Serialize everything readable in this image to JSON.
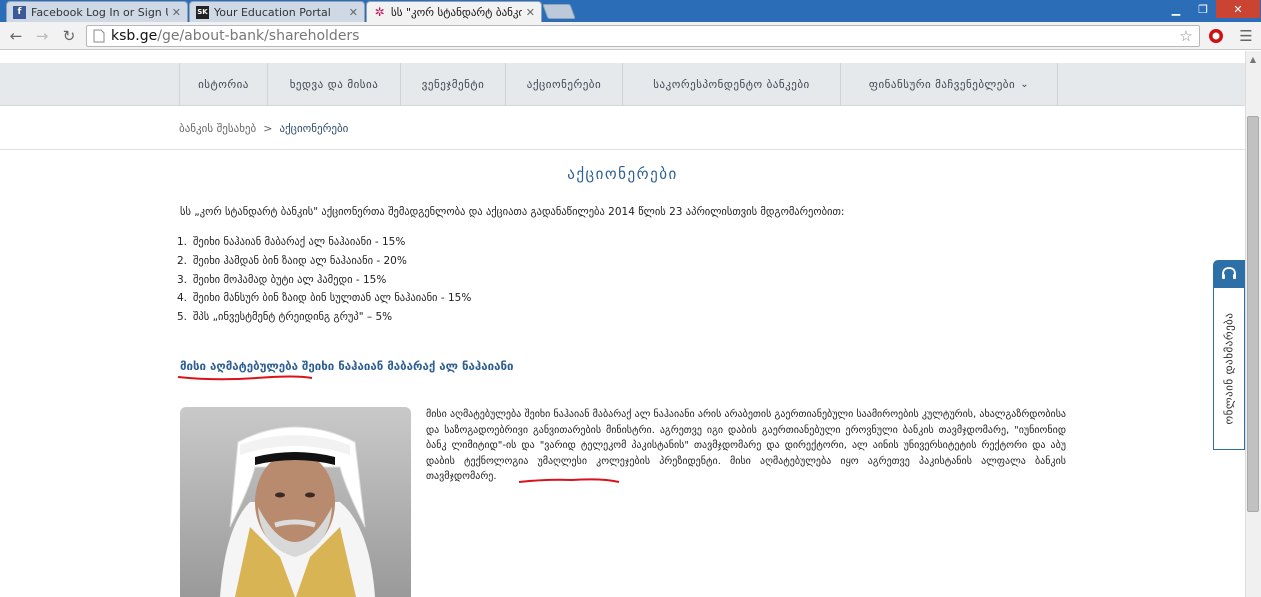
{
  "browser": {
    "tabs": [
      {
        "title": "Facebook   Log In or Sign Up",
        "favicon": "f",
        "active": false
      },
      {
        "title": "Your Education Portal",
        "favicon": "SK",
        "active": false
      },
      {
        "title": "სს \"კორ სტანდარტ ბანკი\"",
        "favicon": "✲",
        "active": true
      }
    ],
    "url_host": "ksb.ge",
    "url_path": "/ge/about-bank/shareholders"
  },
  "nav": {
    "items": [
      "ისტორია",
      "ხედვა და მისია",
      "ვენეჯმენტი",
      "აქციონერები",
      "საკორესპონდენტო ბანკები",
      "ფინანსური მაჩვენებლები"
    ]
  },
  "breadcrumb": {
    "parent": "ბანკის შესახებ",
    "separator": ">",
    "current": "აქციონერები"
  },
  "page": {
    "title": "აქციონერები",
    "intro": "სს „კორ სტანდარტ ბანკის\" აქციონერთა შემადგენლობა და აქციათა გადანაწილება 2014 წლის 23 აპრილისთვის მდგომარეობით:",
    "shareholders": [
      {
        "num": "1.",
        "text": "შეიხი ნაჰაიან მაბარაქ ალ ნაჰაიანი - 15%"
      },
      {
        "num": "2.",
        "text": "შეიხი ჰამდან ბინ ზაიდ ალ ნაჰაიანი - 20%"
      },
      {
        "num": "3.",
        "text": "შეიხი მოჰამად ბუტი ალ ჰამედი - 15%"
      },
      {
        "num": "4.",
        "text": "შეიხი მანსურ ბინ ზაიდ ბინ სულთან ალ ნაჰაიანი - 15%"
      },
      {
        "num": "5.",
        "text": "შპს „ინვესტმენტ ტრეიდინგ გრუპ\" – 5%"
      }
    ],
    "subhead_highlight": "მისი აღმატებულება",
    "subhead_rest": "შეიხი ნაჰაიან მაბარაქ ალ ნაჰაიანი",
    "bio_main": "მისი აღმატებულება შეიხი ნაჰაიან მაბარაქ ალ ნაჰაიანი არის არაბეთის გაერთიანებული საამიროების კულტურის, ახალგაზრდობისა და საზოგადოებრივი განვითარების მინისტრი. აგრეთვე იგი დაბის გაერთიანებული ეროვნული ბანკის თავმჯდომარე, \"იუნიონიდ ბანკ ლიმიტიდ\"-ის და \"ვარიდ ტელეკომ პაკისტანის\" თავმჯდომარე და დირექტორი, ალ აინის უნივერსიტეტის რექტორი და აბუ დაბის ტექნოლოგია უმაღლესი კოლეჯების პრეზიდენტი.",
    "bio_highlight": "მისი აღმატებულება",
    "bio_tail": "იყო აგრეთვე პაკისტანის ალფალა ბანკის თავმჯდომარე."
  },
  "contact_widget": {
    "label": "ონლაინ დახმარება",
    "icon": "headset-icon"
  },
  "colors": {
    "accent": "#2d5f94",
    "annotation": "#d8131c",
    "nav_bg": "#e6e9ec",
    "tabbar": "#2c6db8"
  }
}
